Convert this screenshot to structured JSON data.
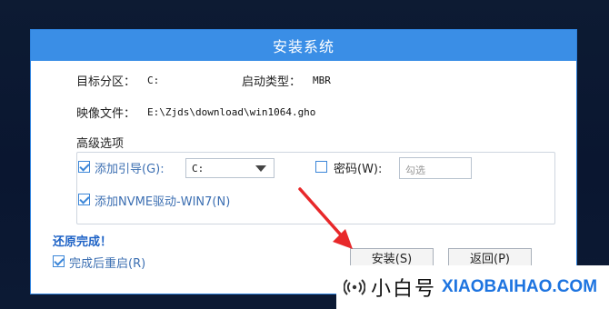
{
  "dialog": {
    "title": "安装系统",
    "target_partition_label": "目标分区：",
    "target_partition_value": "C:",
    "boot_type_label": "启动类型：",
    "boot_type_value": "MBR",
    "image_file_label": "映像文件：",
    "image_file_value": "E:\\Zjds\\download\\win1064.gho",
    "advanced": {
      "title": "高级选项",
      "add_boot_label": "添加引导(G):",
      "add_boot_checked": true,
      "boot_drive_value": "C:",
      "password_label": "密码(W):",
      "password_checked": false,
      "password_placeholder": "勾选",
      "add_nvme_label": "添加NVME驱动-WIN7(N)",
      "add_nvme_checked": true
    },
    "status_text": "还原完成！",
    "restart_label": "完成后重启(R)",
    "restart_checked": true,
    "install_button": "安装(S)",
    "back_button": "返回(P)"
  },
  "watermark": {
    "cn": "小白号",
    "en": "XIAOBAIHAO.COM"
  },
  "colors": {
    "title_bar": "#3a8ee6",
    "accent": "#3b86d8",
    "status": "#1f63c6",
    "arrow": "#e8282a"
  }
}
